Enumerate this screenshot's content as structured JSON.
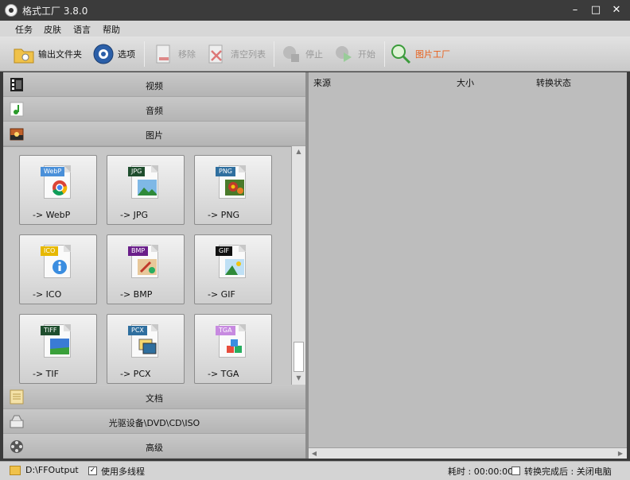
{
  "window": {
    "title": "格式工厂 3.8.0",
    "minimize": "–",
    "maximize": "□",
    "close": "✕"
  },
  "menu": [
    "任务",
    "皮肤",
    "语言",
    "帮助"
  ],
  "toolbar": {
    "output_folder": "输出文件夹",
    "options": "选项",
    "remove": "移除",
    "clear_list": "清空列表",
    "stop": "停止",
    "start": "开始",
    "picture_factory": "图片工厂"
  },
  "categories": {
    "video": "视频",
    "audio": "音频",
    "image": "图片",
    "document": "文档",
    "disc": "光驱设备\\DVD\\CD\\ISO",
    "advanced": "高级"
  },
  "formats": [
    {
      "tag": "WebP",
      "label": "-> WebP",
      "color": "#4a90d9",
      "icon": "chrome-icon"
    },
    {
      "tag": "JPG",
      "label": "-> JPG",
      "color": "#1f4e2e",
      "icon": "landscape-icon"
    },
    {
      "tag": "PNG",
      "label": "-> PNG",
      "color": "#2f6f9f",
      "icon": "flower-icon"
    },
    {
      "tag": "ICO",
      "label": "-> ICO",
      "color": "#e6b800",
      "icon": "info-icon"
    },
    {
      "tag": "BMP",
      "label": "-> BMP",
      "color": "#6a1f8a",
      "icon": "paint-icon"
    },
    {
      "tag": "GIF",
      "label": "-> GIF",
      "color": "#111111",
      "icon": "picture-icon"
    },
    {
      "tag": "TIFF",
      "label": "-> TIF",
      "color": "#1f4e2e",
      "icon": "landscape-icon"
    },
    {
      "tag": "PCX",
      "label": "-> PCX",
      "color": "#2f6f9f",
      "icon": "photos-icon"
    },
    {
      "tag": "TGA",
      "label": "-> TGA",
      "color": "#c78ae0",
      "icon": "cubes-icon"
    }
  ],
  "task_list": {
    "col_source": "来源",
    "col_size": "大小",
    "col_status": "转换状态"
  },
  "status": {
    "output_path": "D:\\FFOutput",
    "multithread": "使用多线程",
    "elapsed": "耗时 : 00:00:00",
    "after_convert": "转换完成后 : 关闭电脑"
  }
}
